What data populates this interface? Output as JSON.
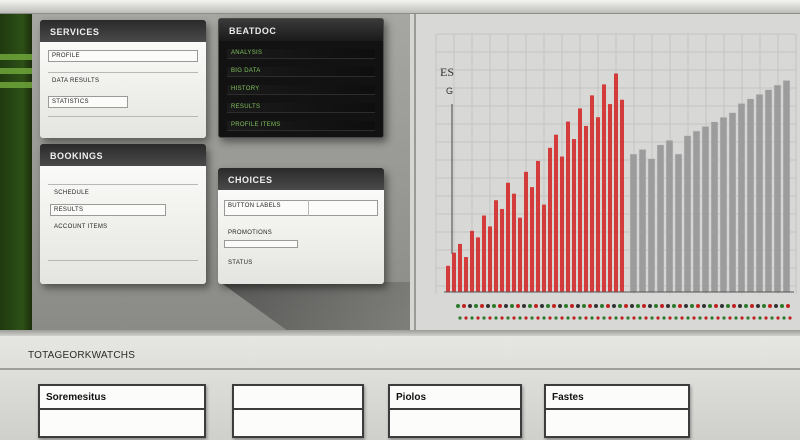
{
  "panels": {
    "top_left": {
      "title": "SERVICES",
      "rows": [
        {
          "label": "PROFILE"
        },
        {
          "label": "DATA RESULTS"
        },
        {
          "label": "STATISTICS"
        }
      ]
    },
    "top_middle": {
      "title": "BEATDOC",
      "rows": [
        {
          "label": "ANALYSIS"
        },
        {
          "label": "BIG DATA"
        },
        {
          "label": "HISTORY"
        },
        {
          "label": "RESULTS"
        },
        {
          "label": "PROFILE ITEMS"
        }
      ]
    },
    "bottom_left": {
      "title": "BOOKINGS",
      "rows": [
        {
          "label": "SCHEDULE"
        },
        {
          "label": "RESULTS"
        },
        {
          "label": "ACCOUNT ITEMS"
        }
      ]
    },
    "bottom_middle": {
      "title": "CHOICES",
      "rows": [
        {
          "label": "BUTTON LABELS"
        },
        {
          "label": "PROMOTIONS"
        },
        {
          "label": "STATUS"
        }
      ]
    }
  },
  "chart_data": {
    "type": "bar",
    "title": "ES",
    "subtitle": "G",
    "xlabel": "",
    "ylabel": "",
    "grid": true,
    "series": [
      {
        "color": "#d42a2a",
        "values": [
          0.12,
          0.18,
          0.22,
          0.16,
          0.28,
          0.25,
          0.35,
          0.3,
          0.42,
          0.38,
          0.5,
          0.45,
          0.34,
          0.55,
          0.48,
          0.6,
          0.4,
          0.66,
          0.72,
          0.62,
          0.78,
          0.7,
          0.84,
          0.76,
          0.9,
          0.8,
          0.95,
          0.86,
          1.0,
          0.88
        ]
      },
      {
        "color": "#9c9c9c",
        "values": [
          0.6,
          0.62,
          0.58,
          0.64,
          0.66,
          0.6,
          0.68,
          0.7,
          0.72,
          0.74,
          0.76,
          0.78,
          0.82,
          0.84,
          0.86,
          0.88,
          0.9,
          0.92
        ]
      }
    ]
  },
  "footer": {
    "title": "TOTAGEORKWATCHS",
    "fields": [
      {
        "label": "Soremesitus"
      },
      {
        "label": ""
      },
      {
        "label": "Piolos"
      },
      {
        "label": "Fastes"
      }
    ]
  }
}
